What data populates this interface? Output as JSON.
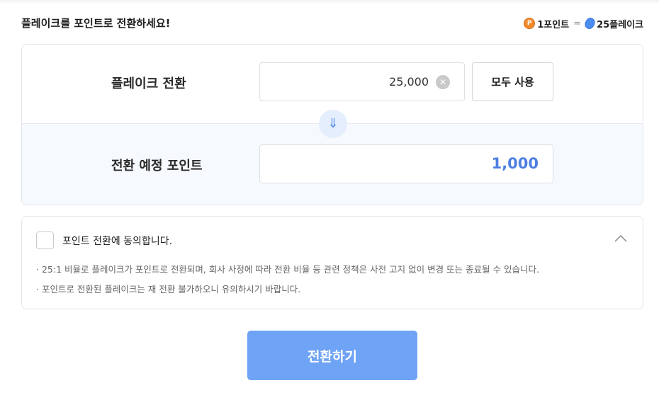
{
  "header": {
    "title": "플레이크를 포인트로 전환하세요!",
    "rate_point": "1포인트",
    "rate_equals": "=",
    "rate_flake": "25플레이크",
    "point_coin_letter": "P"
  },
  "convert": {
    "flake_label": "플레이크 전환",
    "flake_value": "25,000",
    "clear_symbol": "✕",
    "use_all_label": "모두 사용",
    "arrow_symbol": "⇓",
    "point_label": "전환 예정 포인트",
    "point_value": "1,000"
  },
  "agreement": {
    "label": "포인트 전환에 동의합니다.",
    "checked": false,
    "notes": [
      "· 25:1 비율로 플레이크가 포인트로 전환되며, 회사 사정에 따라 전환 비율 등 관련 정책은 사전 고지 없이 변경 또는 종료될 수 있습니다.",
      "· 포인트로 전환된 플레이크는 재 전환 불가하오니 유의하시기 바랍니다."
    ]
  },
  "submit": {
    "label": "전환하기"
  },
  "colors": {
    "accent": "#4d7fe3",
    "submit_bg": "#6fa3f5",
    "point_coin": "#f08a2c",
    "flake_coin": "#4c8cf0"
  },
  "icons": {
    "point_coin": "point-coin-icon",
    "flake_coin": "flake-coin-icon",
    "clear": "clear-icon",
    "arrow": "arrow-down-icon",
    "collapse": "chevron-up-icon"
  }
}
